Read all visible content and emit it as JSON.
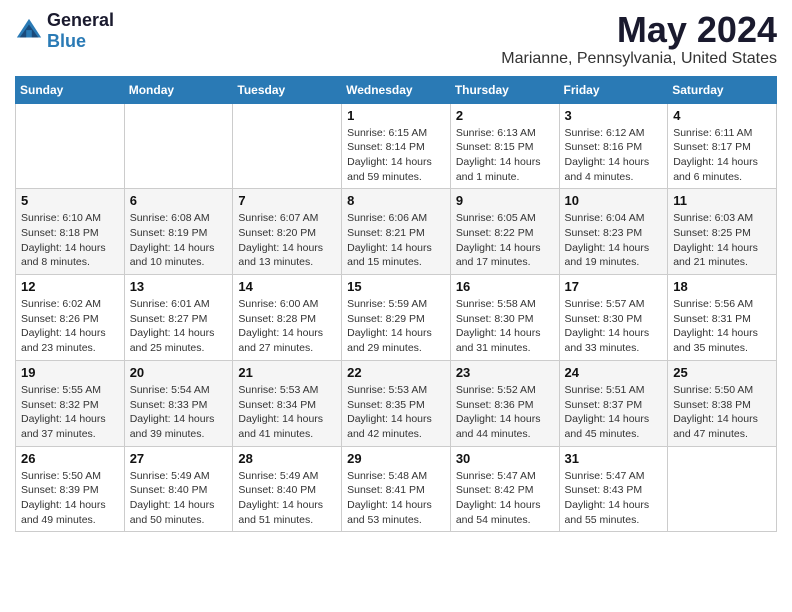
{
  "logo": {
    "text_general": "General",
    "text_blue": "Blue"
  },
  "title": {
    "month": "May 2024",
    "location": "Marianne, Pennsylvania, United States"
  },
  "weekdays": [
    "Sunday",
    "Monday",
    "Tuesday",
    "Wednesday",
    "Thursday",
    "Friday",
    "Saturday"
  ],
  "weeks": [
    [
      {
        "day": "",
        "sunrise": "",
        "sunset": "",
        "daylight": ""
      },
      {
        "day": "",
        "sunrise": "",
        "sunset": "",
        "daylight": ""
      },
      {
        "day": "",
        "sunrise": "",
        "sunset": "",
        "daylight": ""
      },
      {
        "day": "1",
        "sunrise": "Sunrise: 6:15 AM",
        "sunset": "Sunset: 8:14 PM",
        "daylight": "Daylight: 14 hours and 59 minutes."
      },
      {
        "day": "2",
        "sunrise": "Sunrise: 6:13 AM",
        "sunset": "Sunset: 8:15 PM",
        "daylight": "Daylight: 14 hours and 1 minute."
      },
      {
        "day": "3",
        "sunrise": "Sunrise: 6:12 AM",
        "sunset": "Sunset: 8:16 PM",
        "daylight": "Daylight: 14 hours and 4 minutes."
      },
      {
        "day": "4",
        "sunrise": "Sunrise: 6:11 AM",
        "sunset": "Sunset: 8:17 PM",
        "daylight": "Daylight: 14 hours and 6 minutes."
      }
    ],
    [
      {
        "day": "5",
        "sunrise": "Sunrise: 6:10 AM",
        "sunset": "Sunset: 8:18 PM",
        "daylight": "Daylight: 14 hours and 8 minutes."
      },
      {
        "day": "6",
        "sunrise": "Sunrise: 6:08 AM",
        "sunset": "Sunset: 8:19 PM",
        "daylight": "Daylight: 14 hours and 10 minutes."
      },
      {
        "day": "7",
        "sunrise": "Sunrise: 6:07 AM",
        "sunset": "Sunset: 8:20 PM",
        "daylight": "Daylight: 14 hours and 13 minutes."
      },
      {
        "day": "8",
        "sunrise": "Sunrise: 6:06 AM",
        "sunset": "Sunset: 8:21 PM",
        "daylight": "Daylight: 14 hours and 15 minutes."
      },
      {
        "day": "9",
        "sunrise": "Sunrise: 6:05 AM",
        "sunset": "Sunset: 8:22 PM",
        "daylight": "Daylight: 14 hours and 17 minutes."
      },
      {
        "day": "10",
        "sunrise": "Sunrise: 6:04 AM",
        "sunset": "Sunset: 8:23 PM",
        "daylight": "Daylight: 14 hours and 19 minutes."
      },
      {
        "day": "11",
        "sunrise": "Sunrise: 6:03 AM",
        "sunset": "Sunset: 8:25 PM",
        "daylight": "Daylight: 14 hours and 21 minutes."
      }
    ],
    [
      {
        "day": "12",
        "sunrise": "Sunrise: 6:02 AM",
        "sunset": "Sunset: 8:26 PM",
        "daylight": "Daylight: 14 hours and 23 minutes."
      },
      {
        "day": "13",
        "sunrise": "Sunrise: 6:01 AM",
        "sunset": "Sunset: 8:27 PM",
        "daylight": "Daylight: 14 hours and 25 minutes."
      },
      {
        "day": "14",
        "sunrise": "Sunrise: 6:00 AM",
        "sunset": "Sunset: 8:28 PM",
        "daylight": "Daylight: 14 hours and 27 minutes."
      },
      {
        "day": "15",
        "sunrise": "Sunrise: 5:59 AM",
        "sunset": "Sunset: 8:29 PM",
        "daylight": "Daylight: 14 hours and 29 minutes."
      },
      {
        "day": "16",
        "sunrise": "Sunrise: 5:58 AM",
        "sunset": "Sunset: 8:30 PM",
        "daylight": "Daylight: 14 hours and 31 minutes."
      },
      {
        "day": "17",
        "sunrise": "Sunrise: 5:57 AM",
        "sunset": "Sunset: 8:30 PM",
        "daylight": "Daylight: 14 hours and 33 minutes."
      },
      {
        "day": "18",
        "sunrise": "Sunrise: 5:56 AM",
        "sunset": "Sunset: 8:31 PM",
        "daylight": "Daylight: 14 hours and 35 minutes."
      }
    ],
    [
      {
        "day": "19",
        "sunrise": "Sunrise: 5:55 AM",
        "sunset": "Sunset: 8:32 PM",
        "daylight": "Daylight: 14 hours and 37 minutes."
      },
      {
        "day": "20",
        "sunrise": "Sunrise: 5:54 AM",
        "sunset": "Sunset: 8:33 PM",
        "daylight": "Daylight: 14 hours and 39 minutes."
      },
      {
        "day": "21",
        "sunrise": "Sunrise: 5:53 AM",
        "sunset": "Sunset: 8:34 PM",
        "daylight": "Daylight: 14 hours and 41 minutes."
      },
      {
        "day": "22",
        "sunrise": "Sunrise: 5:53 AM",
        "sunset": "Sunset: 8:35 PM",
        "daylight": "Daylight: 14 hours and 42 minutes."
      },
      {
        "day": "23",
        "sunrise": "Sunrise: 5:52 AM",
        "sunset": "Sunset: 8:36 PM",
        "daylight": "Daylight: 14 hours and 44 minutes."
      },
      {
        "day": "24",
        "sunrise": "Sunrise: 5:51 AM",
        "sunset": "Sunset: 8:37 PM",
        "daylight": "Daylight: 14 hours and 45 minutes."
      },
      {
        "day": "25",
        "sunrise": "Sunrise: 5:50 AM",
        "sunset": "Sunset: 8:38 PM",
        "daylight": "Daylight: 14 hours and 47 minutes."
      }
    ],
    [
      {
        "day": "26",
        "sunrise": "Sunrise: 5:50 AM",
        "sunset": "Sunset: 8:39 PM",
        "daylight": "Daylight: 14 hours and 49 minutes."
      },
      {
        "day": "27",
        "sunrise": "Sunrise: 5:49 AM",
        "sunset": "Sunset: 8:40 PM",
        "daylight": "Daylight: 14 hours and 50 minutes."
      },
      {
        "day": "28",
        "sunrise": "Sunrise: 5:49 AM",
        "sunset": "Sunset: 8:40 PM",
        "daylight": "Daylight: 14 hours and 51 minutes."
      },
      {
        "day": "29",
        "sunrise": "Sunrise: 5:48 AM",
        "sunset": "Sunset: 8:41 PM",
        "daylight": "Daylight: 14 hours and 53 minutes."
      },
      {
        "day": "30",
        "sunrise": "Sunrise: 5:47 AM",
        "sunset": "Sunset: 8:42 PM",
        "daylight": "Daylight: 14 hours and 54 minutes."
      },
      {
        "day": "31",
        "sunrise": "Sunrise: 5:47 AM",
        "sunset": "Sunset: 8:43 PM",
        "daylight": "Daylight: 14 hours and 55 minutes."
      },
      {
        "day": "",
        "sunrise": "",
        "sunset": "",
        "daylight": ""
      }
    ]
  ]
}
